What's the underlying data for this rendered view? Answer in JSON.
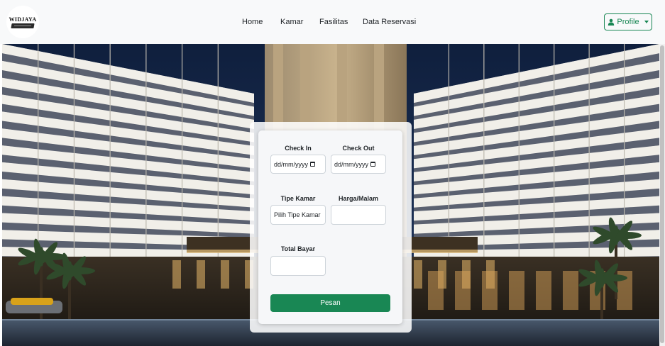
{
  "navbar": {
    "logo_text": "WIDJAYA",
    "links": [
      {
        "label": "Home"
      },
      {
        "label": "Kamar"
      },
      {
        "label": "Fasilitas"
      },
      {
        "label": "Data Reservasi"
      }
    ],
    "profile_label": "Profile"
  },
  "booking": {
    "check_in_label": "Check In",
    "check_in_value": "dd/mm/yyyy",
    "check_out_label": "Check Out",
    "check_out_value": "dd/mm/yyyy",
    "room_type_label": "Tipe Kamar",
    "room_type_value": "Pilih Tipe Kamar",
    "price_label": "Harga/Malam",
    "price_value": "",
    "total_label": "Total Bayar",
    "total_value": "",
    "submit_label": "Pesan"
  },
  "colors": {
    "primary": "#198754",
    "navbar_bg": "#f8f9fa"
  },
  "icons": {
    "profile": "user-icon",
    "dropdown": "caret-down-icon",
    "date": "calendar-icon"
  }
}
